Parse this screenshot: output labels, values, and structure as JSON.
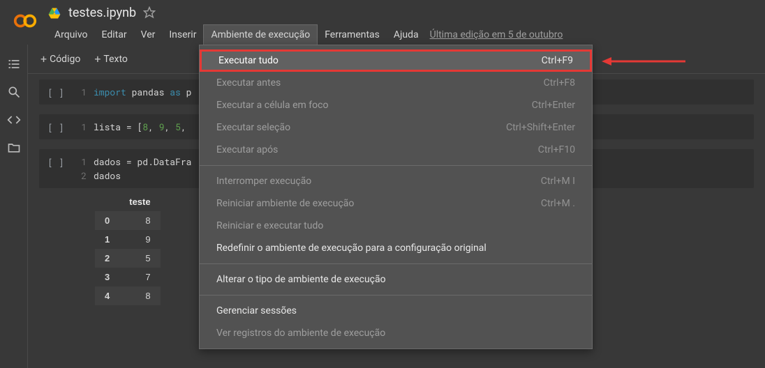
{
  "header": {
    "doc_title": "testes.ipynb",
    "menu": {
      "arquivo": "Arquivo",
      "editar": "Editar",
      "ver": "Ver",
      "inserir": "Inserir",
      "ambiente": "Ambiente de execução",
      "ferramentas": "Ferramentas",
      "ajuda": "Ajuda"
    },
    "last_edit": "Última edição em 5 de outubro"
  },
  "toolbar": {
    "code_label": "Código",
    "text_label": "Texto"
  },
  "cells": [
    {
      "bracket": "[ ]",
      "lines": [
        {
          "n": "1",
          "html": "<span class='tok-kw'>import</span> <span class='tok-id'>pandas</span> <span class='tok-kw'>as</span> <span class='tok-id'>p</span>"
        }
      ]
    },
    {
      "bracket": "[ ]",
      "lines": [
        {
          "n": "1",
          "html": "<span class='tok-id'>lista</span> <span class='tok-op'>=</span> <span class='tok-op'>[</span><span class='tok-num'>8</span><span class='tok-op'>,</span> <span class='tok-num'>9</span><span class='tok-op'>,</span> <span class='tok-num'>5</span><span class='tok-op'>,</span>"
        }
      ]
    },
    {
      "bracket": "[ ]",
      "lines": [
        {
          "n": "1",
          "html": "<span class='tok-id'>dados</span> <span class='tok-op'>=</span> <span class='tok-id'>pd</span><span class='tok-dot'>.</span><span class='tok-id'>DataFra</span>"
        },
        {
          "n": "2",
          "html": "<span class='tok-id'>dados</span>"
        }
      ]
    }
  ],
  "output_table": {
    "col_header": "teste",
    "rows": [
      {
        "idx": "0",
        "val": "8"
      },
      {
        "idx": "1",
        "val": "9"
      },
      {
        "idx": "2",
        "val": "5"
      },
      {
        "idx": "3",
        "val": "7"
      },
      {
        "idx": "4",
        "val": "8"
      }
    ]
  },
  "dropdown": {
    "items": [
      {
        "label": "Executar tudo",
        "shortcut": "Ctrl+F9",
        "highlight": true,
        "enabled": true
      },
      {
        "label": "Executar antes",
        "shortcut": "Ctrl+F8",
        "enabled": false
      },
      {
        "label": "Executar a célula em foco",
        "shortcut": "Ctrl+Enter",
        "enabled": false
      },
      {
        "label": "Executar seleção",
        "shortcut": "Ctrl+Shift+Enter",
        "enabled": false
      },
      {
        "label": "Executar após",
        "shortcut": "Ctrl+F10",
        "enabled": false
      },
      {
        "sep": true
      },
      {
        "label": "Interromper execução",
        "shortcut": "Ctrl+M I",
        "enabled": false
      },
      {
        "label": "Reiniciar ambiente de execução",
        "shortcut": "Ctrl+M .",
        "enabled": false
      },
      {
        "label": "Reiniciar e executar tudo",
        "shortcut": "",
        "enabled": false
      },
      {
        "label": "Redefinir o ambiente de execução para a configuração original",
        "shortcut": "",
        "enabled": true
      },
      {
        "sep": true
      },
      {
        "label": "Alterar o tipo de ambiente de execução",
        "shortcut": "",
        "enabled": true
      },
      {
        "sep": true
      },
      {
        "label": "Gerenciar sessões",
        "shortcut": "",
        "enabled": true
      },
      {
        "label": "Ver registros do ambiente de execução",
        "shortcut": "",
        "enabled": false
      }
    ]
  }
}
